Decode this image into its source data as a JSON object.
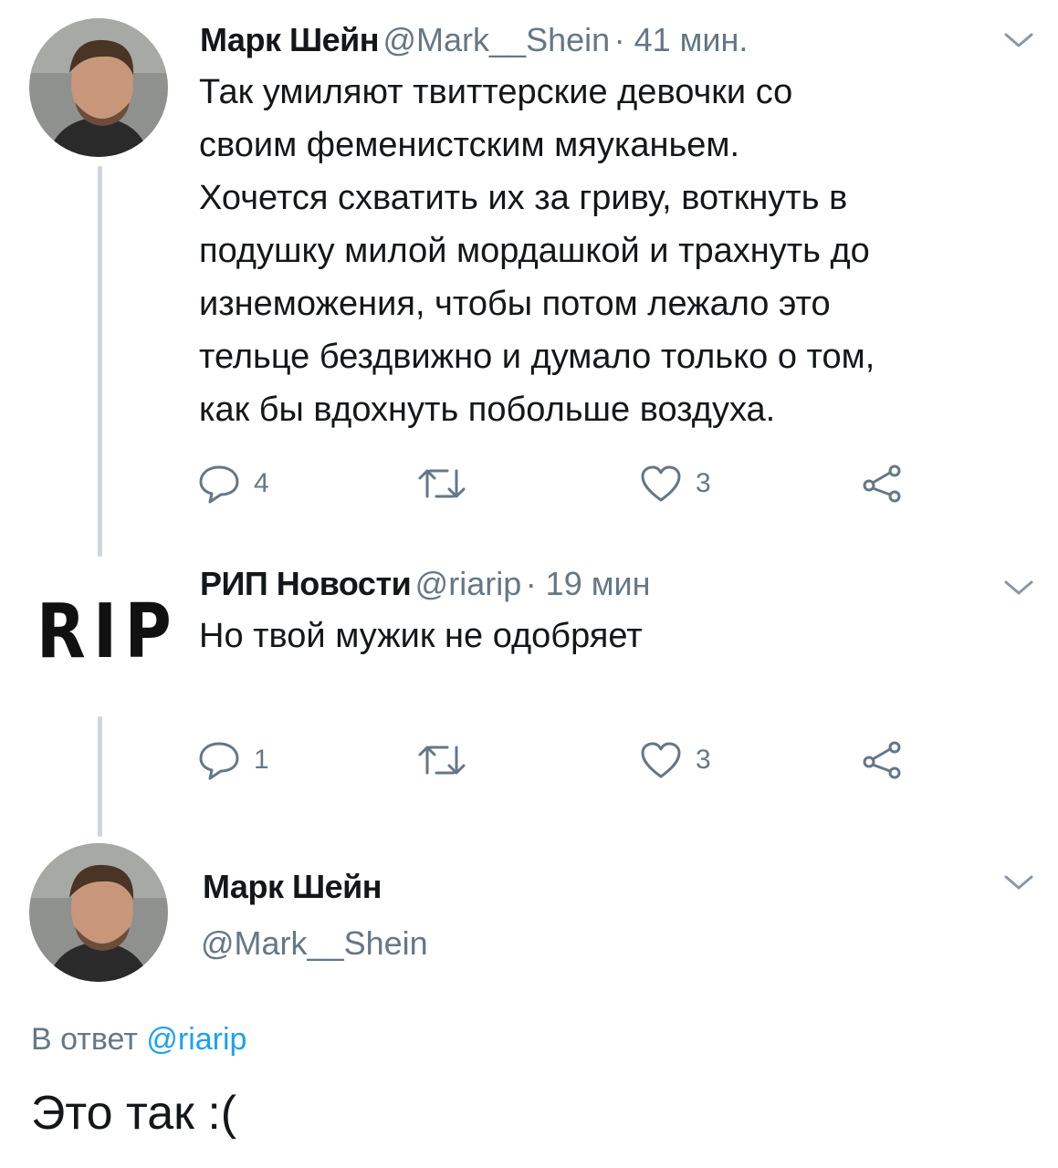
{
  "tweet1": {
    "author": "Марк Шейн",
    "handle": "@Mark__Shein",
    "time": "· 41 мин.",
    "text_lines": [
      "Так умиляют твиттерские девочки со",
      "своим феменистским мяуканьем.",
      "Хочется схватить их за гриву, воткнуть в",
      "подушку милой мордашкой и трахнуть до",
      "изнеможения, чтобы потом лежало это",
      "тельце бездвижно и думало только о том,",
      "как бы вдохнуть побольше воздуха."
    ],
    "replies": "4",
    "likes": "3"
  },
  "tweet2": {
    "author": "РИП Новости",
    "handle": "@riarip",
    "time": "· 19 мин",
    "text": "Но твой мужик не одобряет",
    "avatar_logo": "RIP",
    "replies": "1",
    "likes": "3"
  },
  "tweet3": {
    "author": "Марк Шейн",
    "handle": "@Mark__Shein",
    "reply_prefix": "В ответ",
    "reply_to": "@riarip",
    "text": "Это так :("
  },
  "colors": {
    "text": "#14171a",
    "secondary": "#657786",
    "link": "#1da1f2",
    "thread_line": "#ccd6dd"
  },
  "icons": [
    "reply-icon",
    "retweet-icon",
    "like-icon",
    "share-icon",
    "chevron-down-icon"
  ]
}
